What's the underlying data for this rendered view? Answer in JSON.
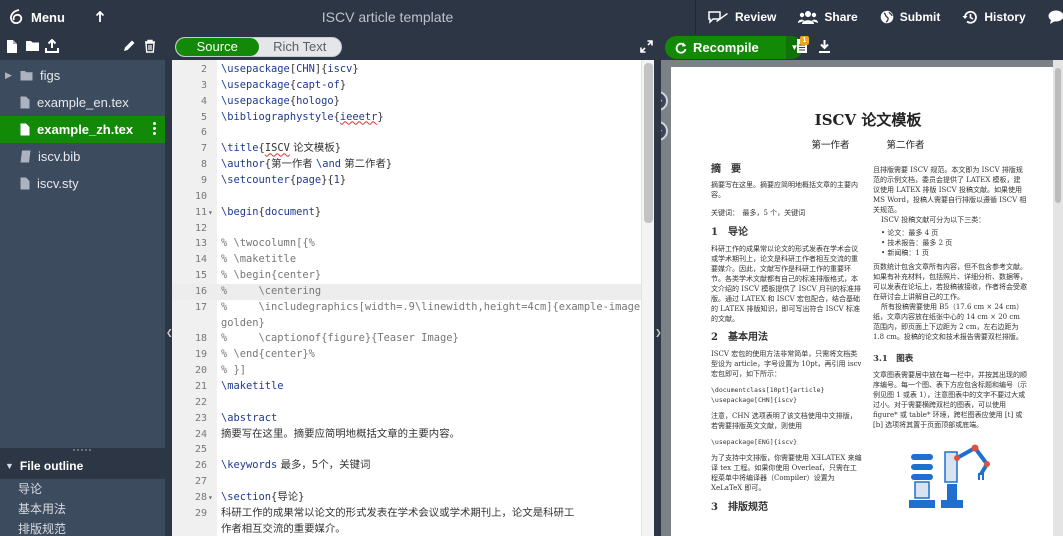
{
  "toolbar": {
    "menu_label": "Menu",
    "title": "ISCV article template",
    "review_label": "Review",
    "share_label": "Share",
    "submit_label": "Submit",
    "history_label": "History",
    "chat_label": "Ch"
  },
  "files": [
    {
      "name": "figs",
      "type": "folder"
    },
    {
      "name": "example_en.tex",
      "type": "file"
    },
    {
      "name": "example_zh.tex",
      "type": "file",
      "active": true
    },
    {
      "name": "iscv.bib",
      "type": "bib"
    },
    {
      "name": "iscv.sty",
      "type": "file"
    }
  ],
  "outline": {
    "title": "File outline",
    "items": [
      "导论",
      "基本用法",
      "排版规范"
    ]
  },
  "editor": {
    "mode_source": "Source",
    "mode_rich": "Rich Text",
    "active_line": "16"
  },
  "pdf": {
    "recompile_label": "Recompile",
    "log_badge": "1",
    "title": "ISCV 论文模板",
    "author1": "第一作者",
    "author2": "第二作者",
    "abstract_heading": "摘　要",
    "abstract_text": "摘要写在这里。摘要应简明地概括文章的主要内容。",
    "keywords": "关键词：　最多，5 个，关键词",
    "sec1_heading": "1　导论",
    "sec1_text": "科研工作的成果常以论文的形式发表在学术会议或学术期刊上，论文是科研工作者相互交流的重要媒介。因此，文献写作是科研工作的重要环节。各类学术文献都有自己的标准排版格式，本文介绍的 ISCV 模板提供了 ISCV 月刊的标准排版。通过 LATEX 和 ISCV 宏包配合，结合基础的 LATEX 排版知识，即可写出符合 ISCV 标准的文献。",
    "sec2_heading": "2　基本用法",
    "sec2_text": "ISCV 宏包的使用方法非常简单，只需将文档类型设为 article，字号设置为 10pt，再引用 iscv 宏包即可，如下所示：",
    "sec2_code1": "\\documentclass[10pt]{article}",
    "sec2_code2": "\\usepackage[CHN]{iscv}",
    "sec2_note": "注意，CHN 选项表明了该文档使用中文排版，若需要排版英文文献，则使用",
    "sec2_code3": "\\usepackage[ENG]{iscv}",
    "sec2_text2": "为了支持中文排版，你需要使用 XƎLATEX 来编译 tex 工程。如果你使用 Overleaf，只需在工程菜单中将编译器（Compiler）设置为 XeLaTeX 即可。",
    "sec3_heading": "3　排版规范",
    "right_text1": "且排版需要 ISCV 规范。本文即为 ISCV 排版规范的示例文档，委员会提供了 LATEX 模板，建议使用 LATEX 排版 ISCV 投稿文献。如果使用 MS Word，投稿人需要自行排版以遵循 ISCV 相关规范。",
    "right_text2": "ISCV 投稿文献可分为以下三类：",
    "bullets": [
      "论文：最多 4 页",
      "技术报告：最多 2 页",
      "新闻稿：1 页"
    ],
    "right_text3": "页数统计包含文章所有内容，但不包含参考文献。如果有补充材料，包括照片、详细分析、数据等，可以发表在论坛上，若投稿被接收，作者将会受邀在研讨会上讲解自己的工作。",
    "right_text4": "所有投稿需要使用 B5（17.6 cm × 24 cm）纸，文章内容放在纸张中心的 14 cm × 20 cm 范围内，即页面上下边距为 2 cm，左右边距为 1.8 cm。投稿的论文和技术报告需要双栏排版。",
    "sub31_heading": "3.1　图表",
    "sub31_text": "文章图表需要居中放在每一栏中，并按其出现的顺序编号。每一个图、表下方应包含标题和编号（示例见图 1 或表 1），注意图表中的文字不要过大或过小。对于需要横跨双栏的图表，可以使用 figure* 或 table* 环境，跨栏图表应使用 [t] 或 [b] 选项将其置于页面顶部或底端。"
  },
  "colors": {
    "accent_green": "#138a07",
    "toolbar_bg": "#2c3645",
    "sidebar_bg": "#3d4b5e"
  }
}
